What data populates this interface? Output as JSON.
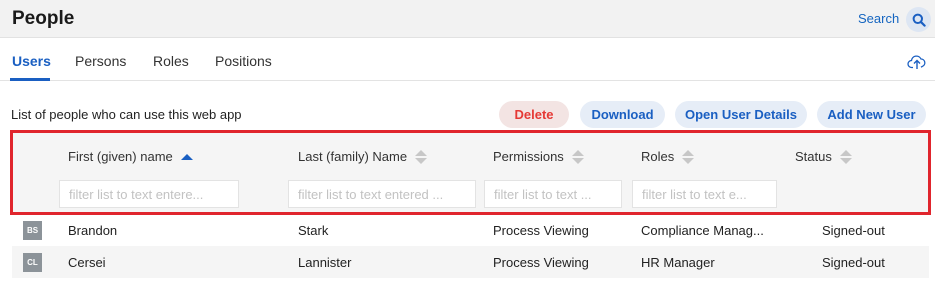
{
  "header": {
    "title": "People",
    "search_label": "Search"
  },
  "tabs": [
    {
      "label": "Users",
      "active": true
    },
    {
      "label": "Persons",
      "active": false
    },
    {
      "label": "Roles",
      "active": false
    },
    {
      "label": "Positions",
      "active": false
    }
  ],
  "toolbar": {
    "description": "List of people who can use this web app",
    "delete_label": "Delete",
    "download_label": "Download",
    "open_details_label": "Open User Details",
    "add_user_label": "Add New User"
  },
  "table": {
    "columns": [
      {
        "label": "First (given) name",
        "sort": "asc",
        "filter_placeholder": "filter list to text entere..."
      },
      {
        "label": "Last (family) Name",
        "sort": "none",
        "filter_placeholder": "filter list to text entered ..."
      },
      {
        "label": "Permissions",
        "sort": "none",
        "filter_placeholder": "filter list to text ..."
      },
      {
        "label": "Roles",
        "sort": "none",
        "filter_placeholder": "filter list to text e..."
      },
      {
        "label": "Status",
        "sort": "none"
      }
    ],
    "rows": [
      {
        "initials": "BS",
        "first": "Brandon",
        "last": "Stark",
        "permissions": "Process Viewing",
        "roles": "Compliance Manag...",
        "status": "Signed-out"
      },
      {
        "initials": "CL",
        "first": "Cersei",
        "last": "Lannister",
        "permissions": "Process Viewing",
        "roles": "HR Manager",
        "status": "Signed-out"
      }
    ]
  },
  "colors": {
    "accent": "#1a5fc2",
    "danger": "#e53935",
    "highlight": "#e0252d"
  }
}
